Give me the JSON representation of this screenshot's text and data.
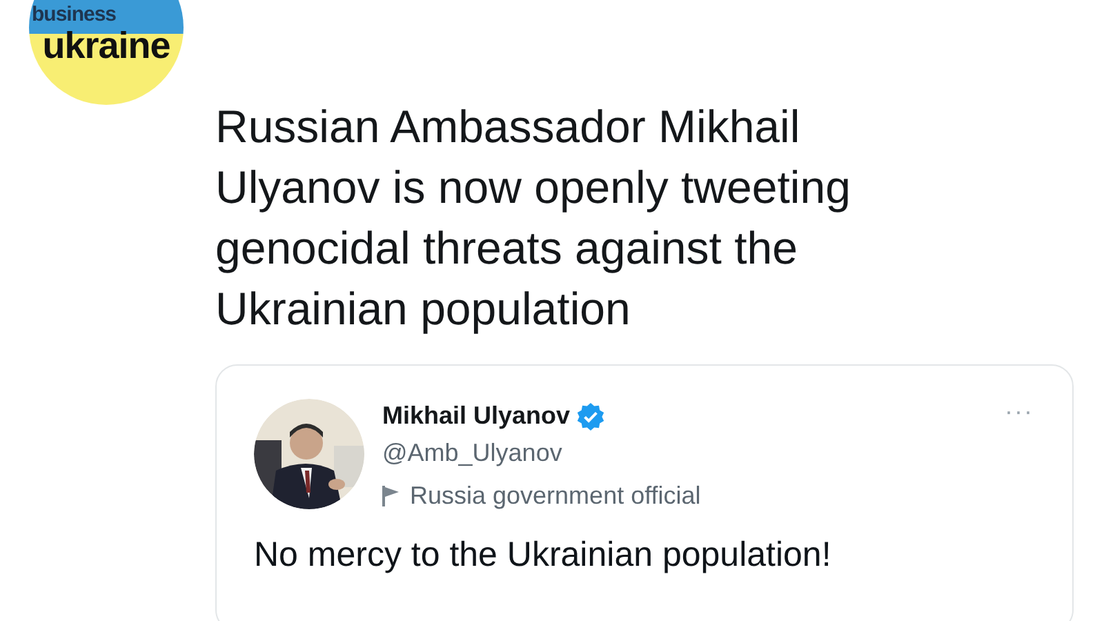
{
  "post": {
    "author_logo": {
      "line_1": "business",
      "line_2": "ukraine"
    },
    "text": "Russian Ambassador Mikhail Ulyanov is now openly tweeting genocidal threats against the Ukrainian population",
    "quoted_tweet": {
      "name": "Mikhail Ulyanov",
      "verified": true,
      "handle": "@Amb_Ulyanov",
      "label": "Russia government official",
      "more": "···",
      "text": "No mercy to the Ukrainian population!"
    }
  }
}
